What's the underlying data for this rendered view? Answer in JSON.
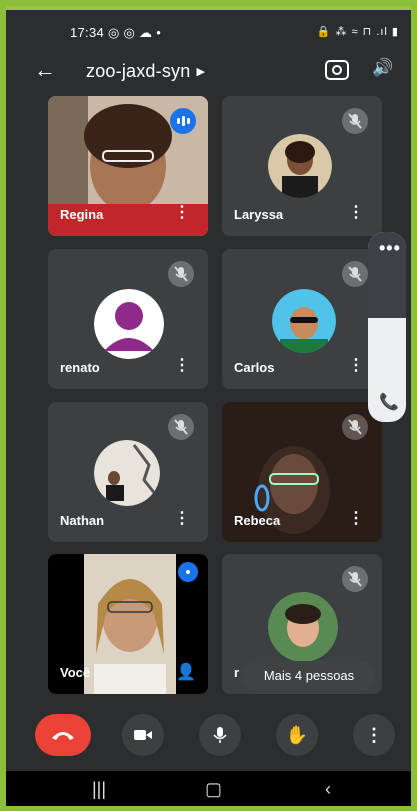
{
  "status": {
    "time": "17:34 ◎ ◎ ☁ •",
    "icons": "🔒 ⁂ ≈ ⊓ .ıl ▮"
  },
  "header": {
    "title": "zoo-jaxd-syn"
  },
  "participants": [
    {
      "name": "Regina"
    },
    {
      "name": "Laryssa"
    },
    {
      "name": "renato"
    },
    {
      "name": "Carlos"
    },
    {
      "name": "Nathan"
    },
    {
      "name": "Rebeca"
    },
    {
      "name": "Você"
    },
    {
      "name": "r"
    }
  ],
  "more_people": "Mais 4 pessoas",
  "colors": {
    "accent": "#1a73e8",
    "end_call": "#ea4335",
    "tile": "#3c4043",
    "frame": "#8bbf3a"
  },
  "icons": {
    "back": "arrow-left-icon",
    "switch_camera": "switch-camera-icon",
    "speaker": "speaker-icon",
    "mic_off": "mic-off-icon",
    "end_call": "phone-hangup-icon",
    "camera": "camera-icon",
    "mic": "mic-icon",
    "hand": "raise-hand-icon",
    "more": "more-vertical-icon"
  }
}
